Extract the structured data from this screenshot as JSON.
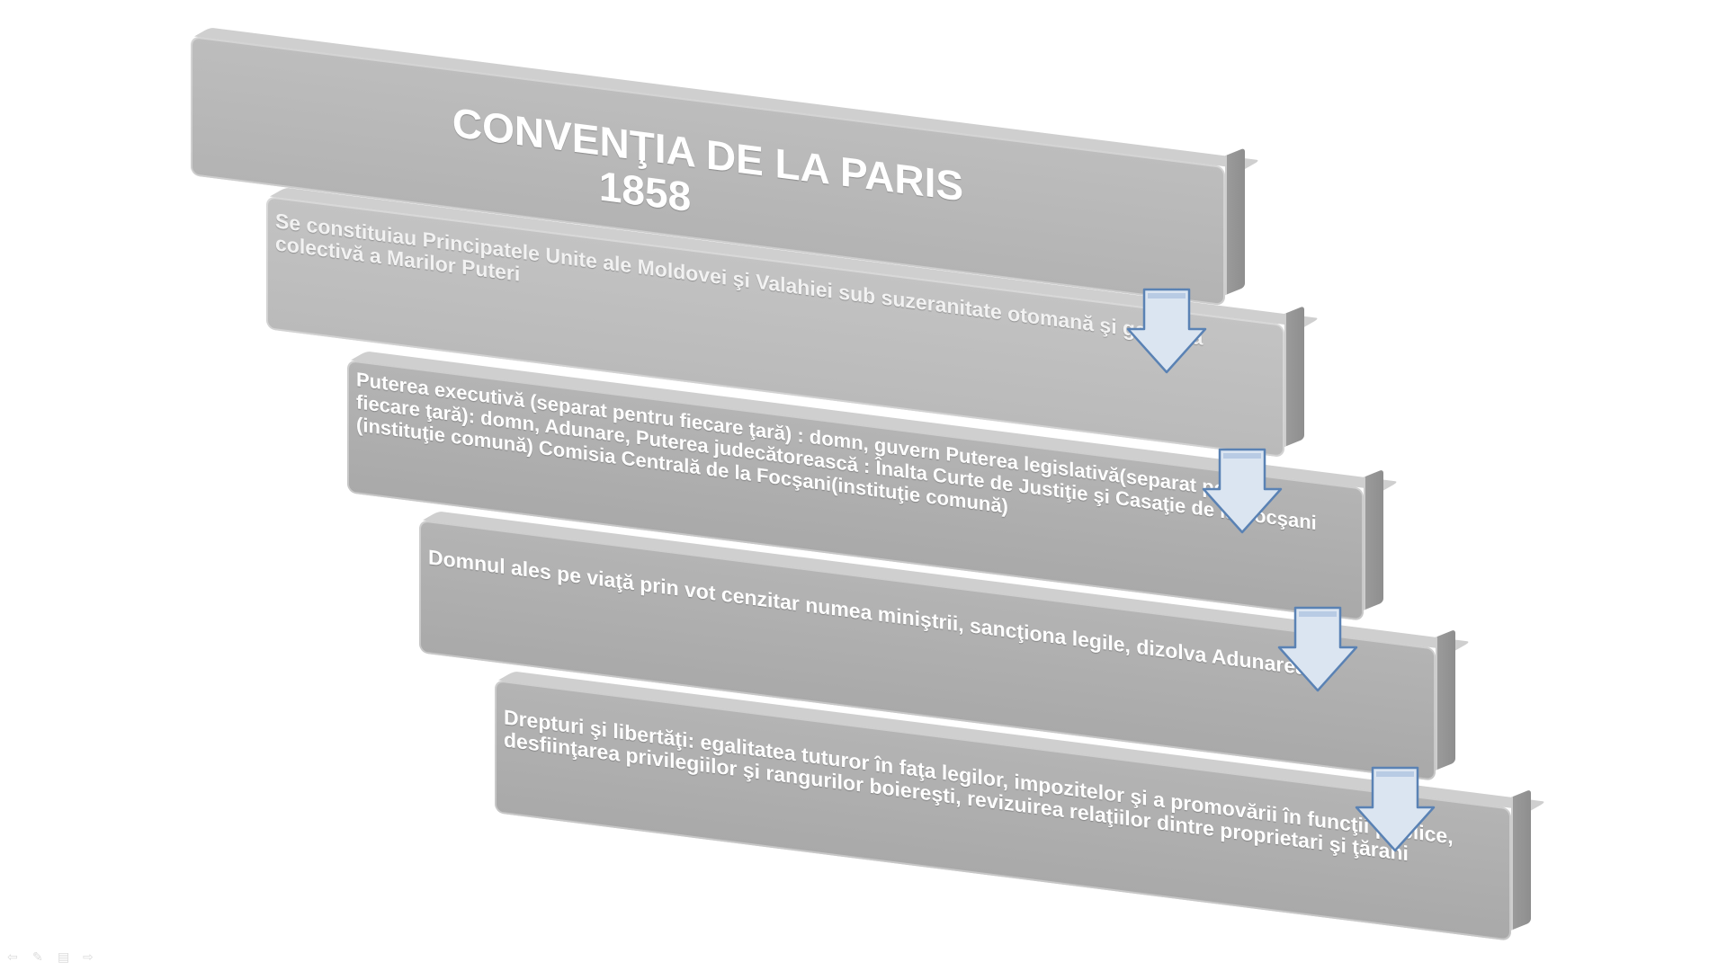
{
  "title": {
    "line1": "CONVENŢIA DE LA PARIS",
    "line2": "1858"
  },
  "steps": [
    {
      "text": "Se constituiau Principatele Unite ale Moldovei şi Valahiei sub suzeranitate otomană şi garanţia colectivă a Marilor Puteri"
    },
    {
      "text": "Puterea executivă (separat pentru fiecare ţară) : domn, guvern Puterea legislativă(separat pentru fiecare ţară): domn, Adunare, Puterea judecătorească : Înalta Curte de Justiţie şi Casaţie de la Focşani (instituţie comună) Comisia Centrală de la Focşani(instituţie comună)"
    },
    {
      "text": "Domnul ales pe viaţă prin vot cenzitar numea miniştrii, sancţiona legile, dizolva Adunarea;"
    },
    {
      "text": "Drepturi şi libertăţi: egalitatea tuturor în faţa legilor, impozitelor şi a promovării în funcţii publice, desfiinţarea privilegiilor şi rangurilor boiereşti, revizuirea relaţiilor dintre proprietari şi ţărani"
    }
  ],
  "colors": {
    "box_face": "#afafaf",
    "box_side": "#939393",
    "text": "#ffffff",
    "arrow_fill": "#dbe5f1",
    "arrow_stroke": "#5a82b4"
  },
  "icons": {
    "arrow": "down-arrow-icon",
    "nav": [
      "prev-slide-icon",
      "pen-icon",
      "menu-icon",
      "next-slide-icon"
    ]
  }
}
